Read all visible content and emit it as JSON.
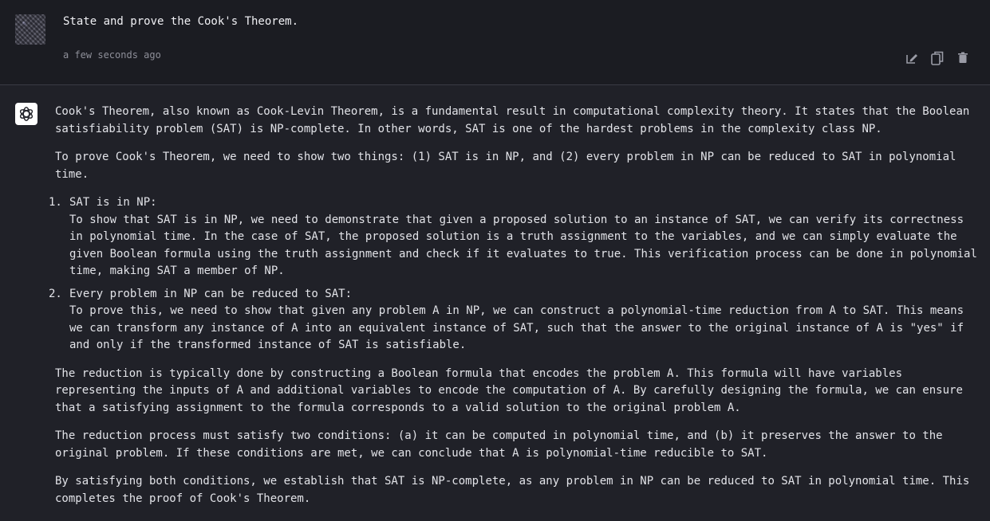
{
  "user_message": {
    "text": "State and prove the Cook's Theorem.",
    "timestamp": "a few seconds ago"
  },
  "assistant_message": {
    "intro": "Cook's Theorem, also known as Cook-Levin Theorem, is a fundamental result in computational complexity theory. It states that the Boolean satisfiability problem (SAT) is NP-complete. In other words, SAT is one of the hardest problems in the complexity class NP.",
    "plan": "To prove Cook's Theorem, we need to show two things: (1) SAT is in NP, and (2) every problem in NP can be reduced to SAT in polynomial time.",
    "list": [
      {
        "number": "1.",
        "heading": "SAT is in NP:",
        "body": "To show that SAT is in NP, we need to demonstrate that given a proposed solution to an instance of SAT, we can verify its correctness in polynomial time. In the case of SAT, the proposed solution is a truth assignment to the variables, and we can simply evaluate the given Boolean formula using the truth assignment and check if it evaluates to true. This verification process can be done in polynomial time, making SAT a member of NP."
      },
      {
        "number": "2.",
        "heading": "Every problem in NP can be reduced to SAT:",
        "body": "To prove this, we need to show that given any problem A in NP, we can construct a polynomial-time reduction from A to SAT. This means we can transform any instance of A into an equivalent instance of SAT, such that the answer to the original instance of A is \"yes\" if and only if the transformed instance of SAT is satisfiable."
      }
    ],
    "reduction": "The reduction is typically done by constructing a Boolean formula that encodes the problem A. This formula will have variables representing the inputs of A and additional variables to encode the computation of A. By carefully designing the formula, we can ensure that a satisfying assignment to the formula corresponds to a valid solution to the original problem A.",
    "conditions": "The reduction process must satisfy two conditions: (a) it can be computed in polynomial time, and (b) it preserves the answer to the original problem. If these conditions are met, we can conclude that A is polynomial-time reducible to SAT.",
    "conclusion": "By satisfying both conditions, we establish that SAT is NP-complete, as any problem in NP can be reduced to SAT in polynomial time. This completes the proof of Cook's Theorem."
  },
  "icons": {
    "edit": "edit-icon",
    "copy": "copy-icon",
    "delete": "trash-icon",
    "assistant": "openai-logo-icon"
  },
  "colors": {
    "background": "#202128",
    "user_background": "#1b1c22",
    "text": "#e2e3e8",
    "muted": "#8e8f99"
  }
}
